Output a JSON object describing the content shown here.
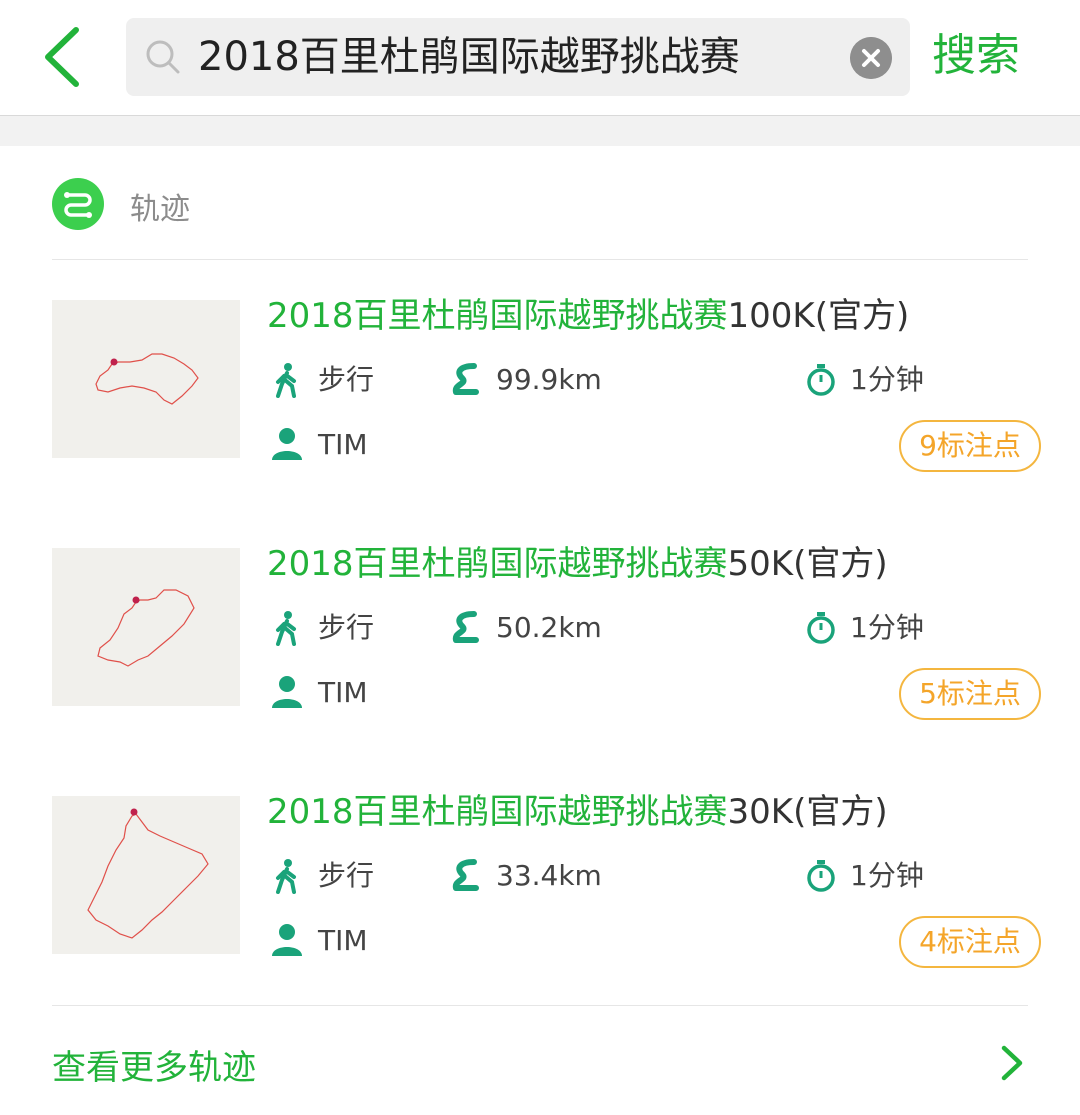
{
  "search": {
    "query": "2018百里杜鹃国际越野挑战赛",
    "button_label": "搜索"
  },
  "section": {
    "label": "轨迹"
  },
  "results": [
    {
      "title_highlight": "2018百里杜鹃国际越野挑战赛",
      "title_rest": "100K(官方)",
      "mode": "步行",
      "distance": "99.9km",
      "duration": "1分钟",
      "author": "TIM",
      "markers": "9标注点"
    },
    {
      "title_highlight": "2018百里杜鹃国际越野挑战赛",
      "title_rest": "50K(官方)",
      "mode": "步行",
      "distance": "50.2km",
      "duration": "1分钟",
      "author": "TIM",
      "markers": "5标注点"
    },
    {
      "title_highlight": "2018百里杜鹃国际越野挑战赛",
      "title_rest": "30K(官方)",
      "mode": "步行",
      "distance": "33.4km",
      "duration": "1分钟",
      "author": "TIM",
      "markers": "4标注点"
    }
  ],
  "footer": {
    "more_label": "查看更多轨迹"
  },
  "colors": {
    "accent_green": "#22b33a",
    "icon_teal": "#1aa37a",
    "badge_orange": "#f4a52a",
    "route_red": "#e0504a"
  },
  "icons": {
    "back": "chevron-left-icon",
    "search": "search-icon",
    "clear": "clear-icon",
    "track": "track-icon",
    "walk": "walking-icon",
    "distance": "route-icon",
    "time": "stopwatch-icon",
    "user": "user-icon",
    "more": "chevron-right-icon"
  }
}
